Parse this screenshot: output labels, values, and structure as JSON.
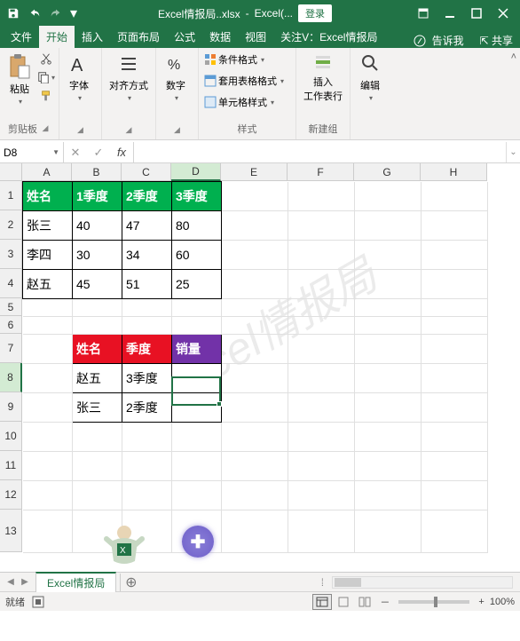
{
  "title": {
    "filename": "Excel情报局..xlsx",
    "appname": "Excel(...",
    "login": "登录"
  },
  "tabs": {
    "file": "文件",
    "home": "开始",
    "insert": "插入",
    "layout": "页面布局",
    "formulas": "公式",
    "data": "数据",
    "view": "视图",
    "attention": "关注V：Excel情报局",
    "tellme": "告诉我",
    "share": "共享"
  },
  "ribbon": {
    "paste": {
      "label": "粘贴",
      "group": "剪贴板"
    },
    "font": {
      "label": "字体"
    },
    "align": {
      "label": "对齐方式"
    },
    "number": {
      "label": "数字"
    },
    "styles": {
      "conditional": "条件格式",
      "table_format": "套用表格格式",
      "cell_style": "单元格样式",
      "group": "样式"
    },
    "insert_row": {
      "label": "插入\n工作表行",
      "group": "新建组"
    },
    "edit": {
      "label": "编辑"
    }
  },
  "namebox": "D8",
  "columns": [
    "A",
    "B",
    "C",
    "D",
    "E",
    "F",
    "G",
    "H"
  ],
  "rows": [
    "1",
    "2",
    "3",
    "4",
    "5",
    "6",
    "7",
    "8",
    "9",
    "10",
    "11",
    "12",
    "13"
  ],
  "selected_col": "D",
  "selected_row": "8",
  "table1": {
    "headers": [
      "姓名",
      "1季度",
      "2季度",
      "3季度"
    ],
    "rows": [
      [
        "张三",
        "40",
        "47",
        "80"
      ],
      [
        "李四",
        "30",
        "34",
        "60"
      ],
      [
        "赵五",
        "45",
        "51",
        "25"
      ]
    ]
  },
  "table2": {
    "headers": [
      "姓名",
      "季度",
      "销量"
    ],
    "rows": [
      [
        "赵五",
        "3季度",
        ""
      ],
      [
        "张三",
        "2季度",
        ""
      ]
    ]
  },
  "watermark": "Excel情报局",
  "sheet": {
    "name": "Excel情报局"
  },
  "status": {
    "ready": "就绪",
    "zoom": "100%",
    "plus": "+",
    "minus": "－"
  }
}
